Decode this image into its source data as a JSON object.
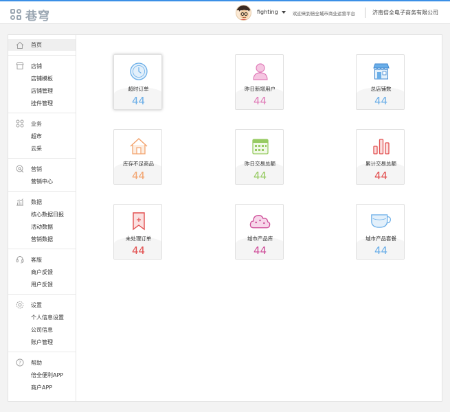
{
  "header": {
    "logo_text": "巷穹",
    "user_name": "fighting",
    "welcome": "欢迎来到倍全城市商业运营平台",
    "company": "济南倍全电子商务有限公司"
  },
  "colors": {
    "accent": "#3b8fe6",
    "blue": "#6aaee8",
    "pink": "#e07bb8",
    "orange": "#f3a36e",
    "green": "#97cb62",
    "red": "#e24f4f",
    "purple": "#cf4f9a"
  },
  "sidebar": {
    "home": {
      "label": "首页",
      "icon": "home-icon"
    },
    "sections": [
      {
        "label": "店铺",
        "icon": "store-icon",
        "items": [
          "店铺模板",
          "店铺管理",
          "挂件管理"
        ]
      },
      {
        "label": "业务",
        "icon": "grid-icon",
        "items": [
          "超市",
          "云采"
        ]
      },
      {
        "label": "营销",
        "icon": "marketing-icon",
        "items": [
          "营销中心"
        ]
      },
      {
        "label": "数据",
        "icon": "chart-icon",
        "items": [
          "核心数据日报",
          "活动数据",
          "营销数据"
        ]
      },
      {
        "label": "客服",
        "icon": "headset-icon",
        "items": [
          "商户反馈",
          "用户反馈"
        ]
      },
      {
        "label": "设置",
        "icon": "gear-icon",
        "items": [
          "个人信息设置",
          "公司信息",
          "账户管理"
        ]
      },
      {
        "label": "帮助",
        "icon": "help-icon",
        "items": [
          "倍全便利APP",
          "商户APP"
        ]
      }
    ]
  },
  "cards": [
    {
      "label": "超时订单",
      "value": "44",
      "icon": "clock-icon",
      "color": "#6aaee8"
    },
    {
      "label": "昨日新增用户",
      "value": "44",
      "icon": "user-icon",
      "color": "#e07bb8"
    },
    {
      "label": "总店铺数",
      "value": "44",
      "icon": "shop-icon",
      "color": "#6aaee8"
    },
    {
      "label": "库存不足商品",
      "value": "44",
      "icon": "house-icon",
      "color": "#f3a36e"
    },
    {
      "label": "昨日交易总额",
      "value": "44",
      "icon": "calendar-icon",
      "color": "#97cb62"
    },
    {
      "label": "累计交易总额",
      "value": "44",
      "icon": "bars-icon",
      "color": "#e24f4f"
    },
    {
      "label": "未处理订单",
      "value": "44",
      "icon": "bookmark-icon",
      "color": "#e24f4f"
    },
    {
      "label": "城市产品库",
      "value": "44",
      "icon": "cloud-icon",
      "color": "#cf4f9a"
    },
    {
      "label": "城市产品套餐",
      "value": "44",
      "icon": "cup-icon",
      "color": "#6aaee8"
    }
  ]
}
